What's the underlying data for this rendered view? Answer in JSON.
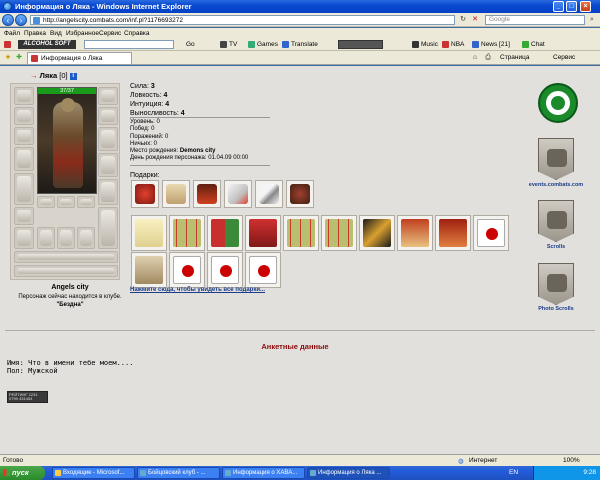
{
  "window": {
    "title": "Информация о Ляка - Windows Internet Explorer",
    "url": "http://angelscity.combats.com/inf.pl?1176693272",
    "search_placeholder": "Google"
  },
  "menu": [
    "Файл",
    "Правка",
    "Вид",
    "Избранное",
    "Сервис",
    "Справка"
  ],
  "toolbar2": {
    "brand": "ALCOHOL SOFT",
    "go": "Go",
    "items": [
      "TV",
      "Games",
      "Translate",
      "Music",
      "NBA",
      "News [21]",
      "Chat"
    ]
  },
  "tab": {
    "label": "Информация о Ляка",
    "right_items": [
      "Страница",
      "Сервис"
    ]
  },
  "character": {
    "name": "Ляка",
    "level": "[0]",
    "hp": "37/37",
    "city": "Angels city",
    "club_status": "Персонаж сейчас находится в клубе.",
    "club_room": "\"Бездна\""
  },
  "stats": {
    "strength_label": "Сила:",
    "strength": "3",
    "agility_label": "Ловкость:",
    "agility": "4",
    "intuition_label": "Интуиция:",
    "intuition": "4",
    "endurance_label": "Выносливость:",
    "endurance": "4"
  },
  "details": {
    "level_label": "Уровень:",
    "level": "0",
    "wins_label": "Побед:",
    "wins": "0",
    "losses_label": "Поражений:",
    "losses": "0",
    "draws_label": "Ничьих:",
    "draws": "0",
    "birthplace_label": "Место рождения:",
    "birthplace": "Demons city",
    "birthday_label": "День рождения персонажа:",
    "birthday": "01.04.09 00:00"
  },
  "gifts": {
    "label": "Подарки:",
    "more_link": "Нажмите сюда, чтобы увидеть все подарки..."
  },
  "sidebar": {
    "events_label": "events.combats.com",
    "scrolls_label": "Scrolls",
    "scrolls2_label": "Scrolls",
    "photo_scrolls_label": "Photo Scrolls"
  },
  "profile": {
    "section_title": "Анкетные данные",
    "name_line": "Имя: Что в имени тебе моем....",
    "gender_line": "Пол: Мужской"
  },
  "counter_text": "РЕЙТИНГ 1231 0799 431454",
  "statusbar": {
    "left": "Готово",
    "zone": "Интернет",
    "zoom": "100%"
  },
  "taskbar": {
    "start": "пуск",
    "tasks": [
      "Входящие - Microsof...",
      "Бойцовский клуб - ...",
      "Информация о ХАВА...",
      "Информация о Ляка ..."
    ],
    "lang": "EN",
    "clock": "9:28"
  }
}
